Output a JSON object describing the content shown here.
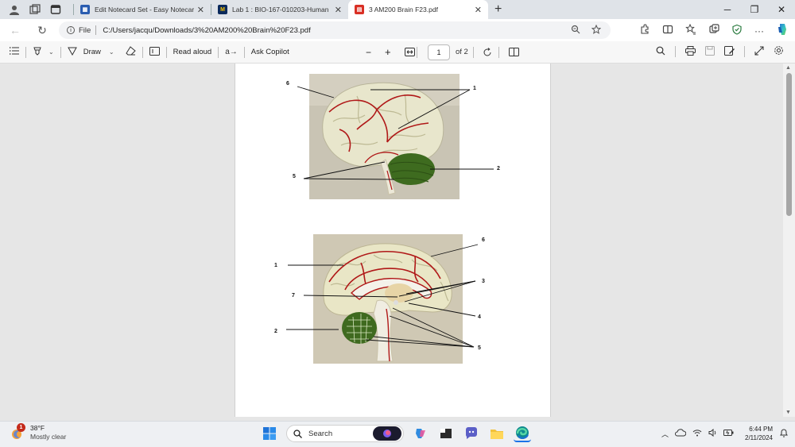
{
  "tabs": [
    {
      "title": "Edit Notecard Set - Easy Notecar",
      "favicon_color": "#2a5db0"
    },
    {
      "title": "Lab 1 : BIO-167-010203-Human",
      "favicon_color": "#0b2a5c"
    },
    {
      "title": "3 AM200 Brain F23.pdf",
      "favicon_color": "#d93025"
    }
  ],
  "address": {
    "scheme_label": "File",
    "url": "C:/Users/jacqu/Downloads/3%20AM200%20Brain%20F23.pdf"
  },
  "pdf_toolbar": {
    "draw_label": "Draw",
    "read_aloud_label": "Read aloud",
    "ask_copilot_label": "Ask Copilot",
    "page_number": "1",
    "page_of": "of 2"
  },
  "figure1_labels": {
    "l6": "6",
    "l1": "1",
    "l5": "5",
    "l2": "2"
  },
  "figure2_labels": {
    "l6": "6",
    "l1": "1",
    "l3": "3",
    "l7": "7",
    "l4": "4",
    "l2": "2",
    "l5": "5"
  },
  "weather": {
    "temp": "38°F",
    "condition": "Mostly clear",
    "badge": "1"
  },
  "taskbar": {
    "search_placeholder": "Search"
  },
  "clock": {
    "time": "6:44 PM",
    "date": "2/11/2024"
  }
}
